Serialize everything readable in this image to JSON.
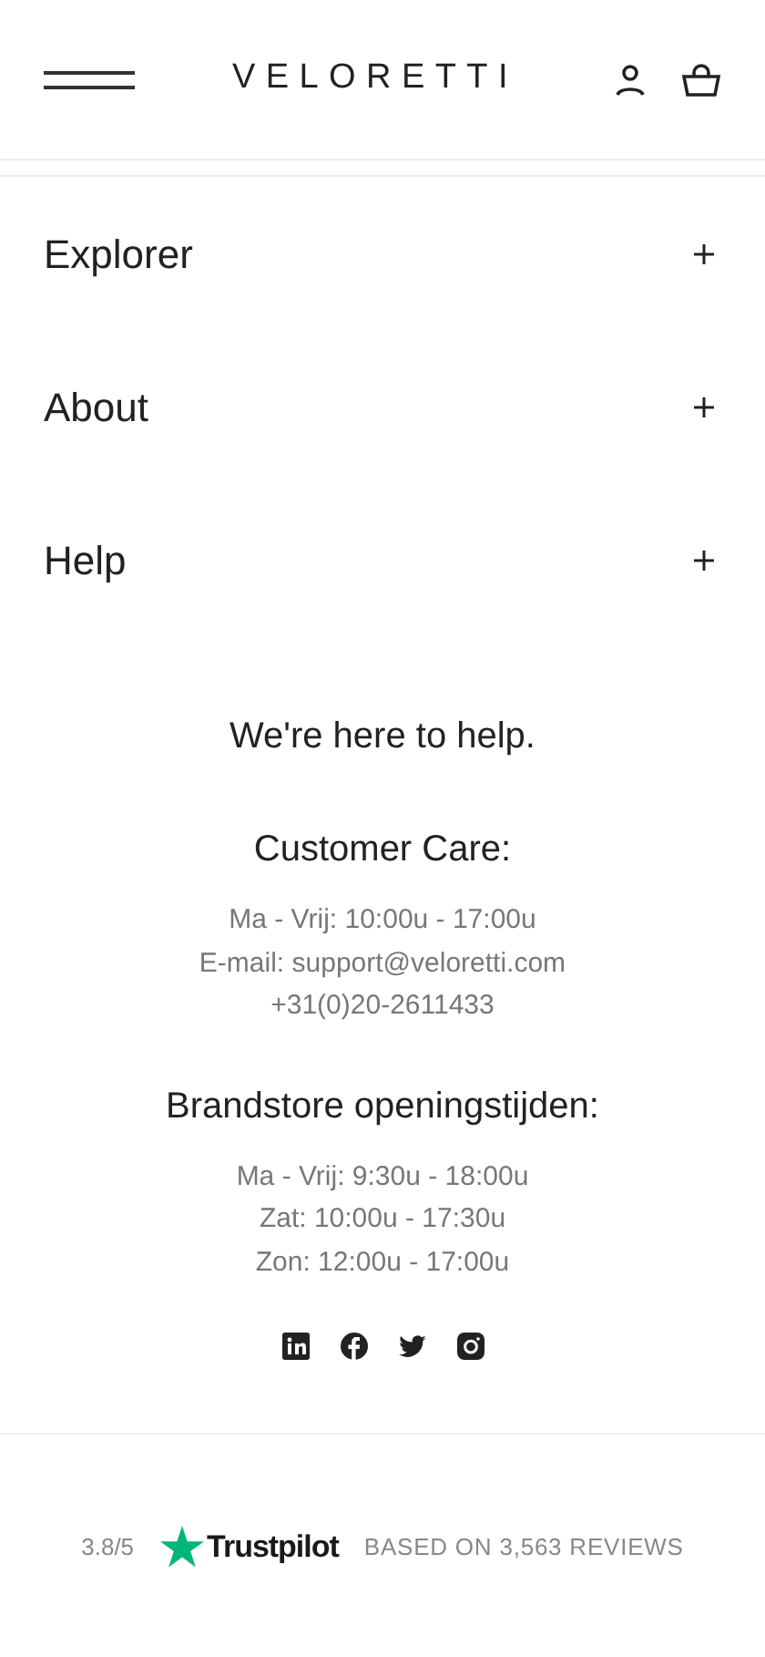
{
  "header": {
    "logo": "VELORETTI"
  },
  "accordion": [
    {
      "label": "Explorer",
      "expanded": false
    },
    {
      "label": "About",
      "expanded": false
    },
    {
      "label": "Help",
      "expanded": false
    }
  ],
  "contact": {
    "title": "We're here to help.",
    "sections": [
      {
        "heading": "Customer Care:",
        "lines": [
          "Ma - Vrij: 10:00u - 17:00u",
          "E-mail: support@veloretti.com",
          "+31(0)20-2611433"
        ]
      },
      {
        "heading": "Brandstore openingstijden:",
        "lines": [
          "Ma - Vrij: 9:30u - 18:00u",
          "Zat: 10:00u - 17:30u",
          "Zon: 12:00u - 17:00u"
        ]
      }
    ],
    "social_links": [
      {
        "kind": "linkedin"
      },
      {
        "kind": "facebook"
      },
      {
        "kind": "twitter"
      },
      {
        "kind": "instagram"
      }
    ]
  },
  "trustpilot": {
    "rating": "3.8/5",
    "brand": "Trustpilot",
    "reviews": "BASED ON 3,563 REVIEWS"
  }
}
